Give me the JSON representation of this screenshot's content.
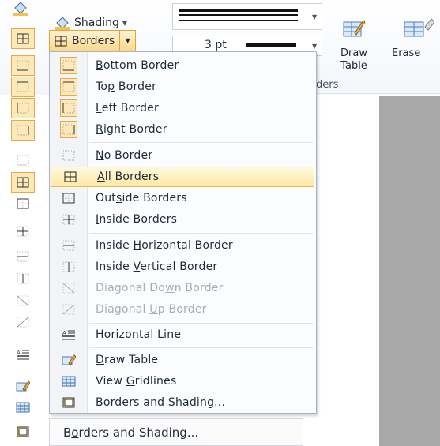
{
  "ribbon": {
    "shading_label": "Shading",
    "borders_label": "Borders",
    "pen_weight": "3 pt",
    "draw_table_label_1": "Draw",
    "draw_table_label_2": "Table",
    "eraser_label": "Erase",
    "group_label_partial": "ders"
  },
  "menu": {
    "items": [
      {
        "pre": "",
        "key": "B",
        "post": "ottom Border",
        "icon": "bottom-border-icon",
        "disabled": false
      },
      {
        "pre": "To",
        "key": "p",
        "post": " Border",
        "icon": "top-border-icon",
        "disabled": false
      },
      {
        "pre": "",
        "key": "L",
        "post": "eft Border",
        "icon": "left-border-icon",
        "disabled": false
      },
      {
        "pre": "",
        "key": "R",
        "post": "ight Border",
        "icon": "right-border-icon",
        "disabled": false
      },
      {
        "pre": "",
        "key": "N",
        "post": "o Border",
        "icon": "no-border-icon",
        "disabled": false
      },
      {
        "pre": "",
        "key": "A",
        "post": "ll Borders",
        "icon": "all-borders-icon",
        "disabled": false,
        "highlighted": true
      },
      {
        "pre": "Out",
        "key": "s",
        "post": "ide Borders",
        "icon": "outside-borders-icon",
        "disabled": false
      },
      {
        "pre": "",
        "key": "I",
        "post": "nside Borders",
        "icon": "inside-borders-icon",
        "disabled": false
      },
      {
        "pre": "Inside ",
        "key": "H",
        "post": "orizontal Border",
        "icon": "inside-horizontal-border-icon",
        "disabled": false
      },
      {
        "pre": "Inside ",
        "key": "V",
        "post": "ertical Border",
        "icon": "inside-vertical-border-icon",
        "disabled": false
      },
      {
        "pre": "Diagonal Do",
        "key": "w",
        "post": "n Border",
        "icon": "diagonal-down-border-icon",
        "disabled": true
      },
      {
        "pre": "Diagonal ",
        "key": "U",
        "post": "p Border",
        "icon": "diagonal-up-border-icon",
        "disabled": true
      },
      {
        "pre": "Hori",
        "key": "z",
        "post": "ontal Line",
        "icon": "horizontal-line-icon",
        "disabled": false
      },
      {
        "pre": "",
        "key": "D",
        "post": "raw Table",
        "icon": "draw-table-icon",
        "disabled": false
      },
      {
        "pre": "View ",
        "key": "G",
        "post": "ridlines",
        "icon": "view-gridlines-icon",
        "disabled": false
      },
      {
        "pre": "B",
        "key": "o",
        "post": "rders and Shading...",
        "icon": "borders-and-shading-icon",
        "disabled": false
      }
    ]
  },
  "bg_menu": {
    "bottom_item_pre": "B",
    "bottom_item_key": "o",
    "bottom_item_post": "rders and Shading..."
  },
  "colors": {
    "highlight": "#fde8a6",
    "highlight_border": "#e8b857",
    "disabled_text": "#a6adb8"
  }
}
